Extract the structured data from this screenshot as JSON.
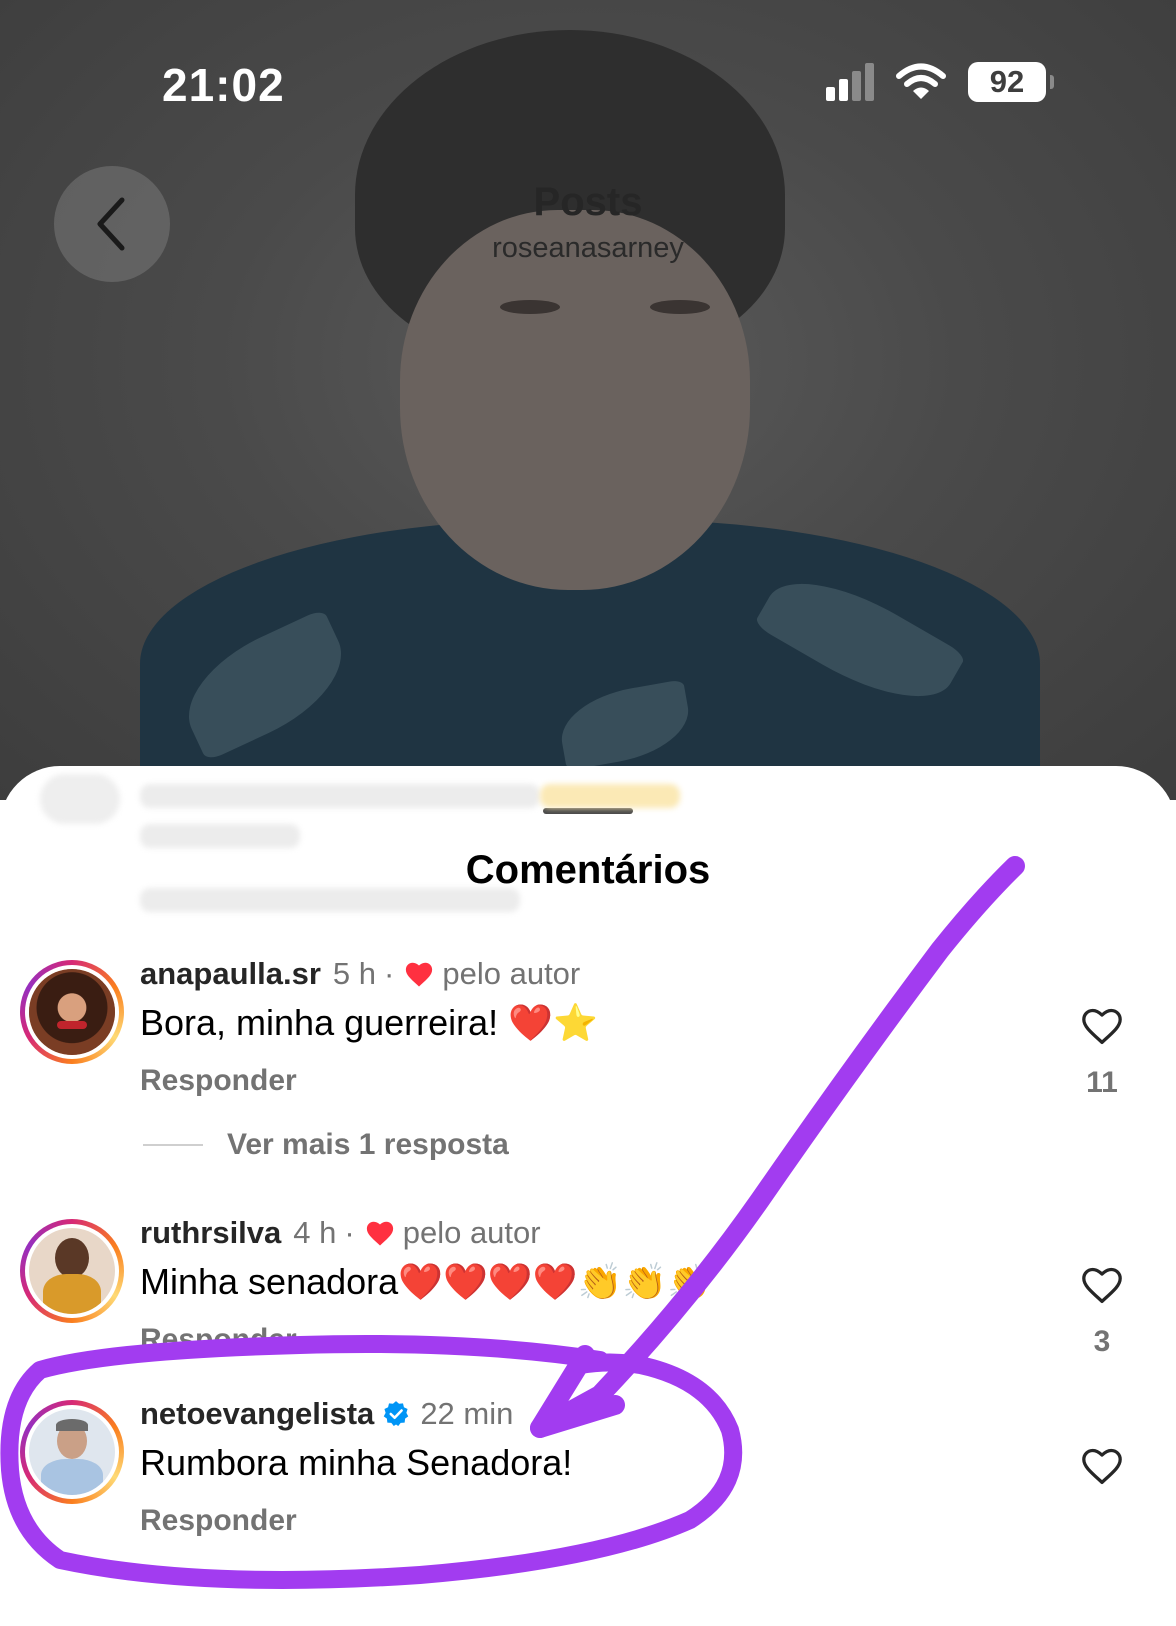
{
  "status_bar": {
    "time": "21:02",
    "battery": "92"
  },
  "nav": {
    "title": "Posts",
    "subtitle": "roseanasarney"
  },
  "sheet": {
    "title": "Comentários"
  },
  "comments": [
    {
      "username": "anapaulla.sr",
      "time": "5 h",
      "liked_by_author": "pelo autor",
      "text": "Bora, minha guerreira! ❤️⭐",
      "reply_label": "Responder",
      "like_count": "11",
      "more_replies": "Ver mais 1 resposta"
    },
    {
      "username": "ruthrsilva",
      "time": "4 h",
      "liked_by_author": "pelo autor",
      "text": "Minha senadora❤️❤️❤️❤️👏👏👏",
      "reply_label": "Responder",
      "like_count": "3"
    },
    {
      "username": "netoevangelista",
      "time": "22 min",
      "verified": true,
      "text": "Rumbora minha Senadora!",
      "reply_label": "Responder"
    }
  ],
  "colors": {
    "annotation": "#a23cf0",
    "heart_red": "#ff3040",
    "verified_blue": "#0095f6"
  },
  "icons": [
    "back-chevron-icon",
    "signal-icon",
    "wifi-icon",
    "battery-icon",
    "heart-outline-icon",
    "red-heart-icon",
    "verified-badge-icon"
  ]
}
